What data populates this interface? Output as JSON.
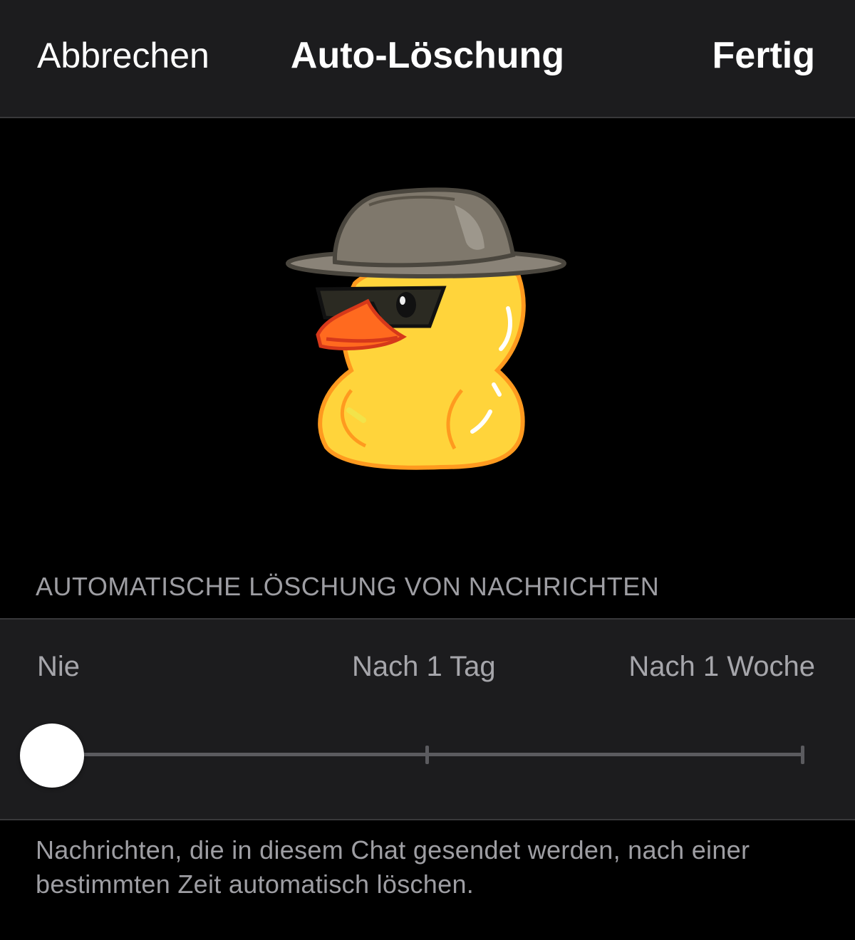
{
  "nav": {
    "cancel_label": "Abbrechen",
    "title": "Auto-Löschung",
    "done_label": "Fertig"
  },
  "sticker": {
    "icon": "duck-with-hat-and-sunglasses-sticker"
  },
  "section": {
    "header": "AUTOMATISCHE LÖSCHUNG VON NACHRICHTEN"
  },
  "slider": {
    "options": [
      "Nie",
      "Nach 1 Tag",
      "Nach 1 Woche"
    ],
    "selected_index": 0,
    "selected_value": "Nie"
  },
  "footer": {
    "text": "Nachrichten, die in diesem Chat gesendet werden, nach einer bestimmten Zeit automatisch löschen."
  },
  "colors": {
    "background": "#000000",
    "card": "#1c1c1e",
    "separator": "#38383a",
    "secondary_text": "#9e9ea3",
    "track": "#5b5b5f",
    "thumb": "#ffffff",
    "duck_body": "#ffd43b",
    "duck_beak": "#ff6a1f",
    "hat": "#8a8378"
  }
}
